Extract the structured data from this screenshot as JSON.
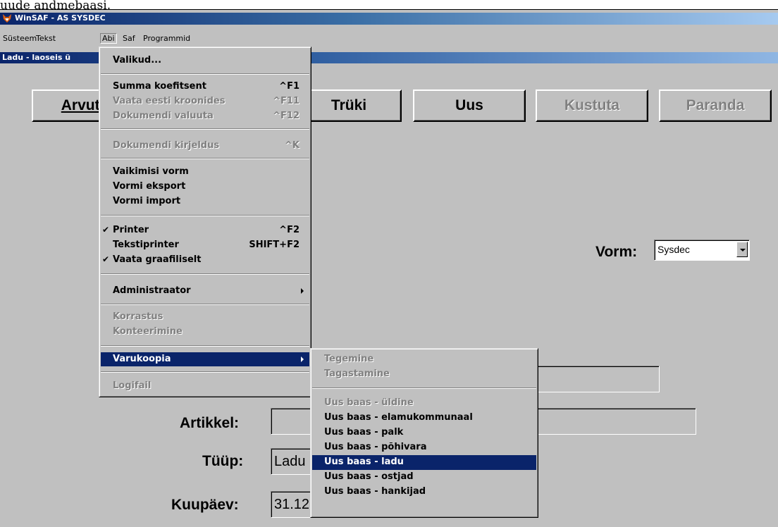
{
  "caption": "uude andmebaasi.",
  "window": {
    "title": "WinSAF - AS SYSDEC"
  },
  "menubar": [
    "Süsteem",
    "Tekst",
    "Abi",
    "Saf",
    "Programmid"
  ],
  "child_window": {
    "title": "Ladu - laoseis ü"
  },
  "toolbar": {
    "arvuta": "Arvuta",
    "truki": "Trüki",
    "uus": "Uus",
    "kustuta": "Kustuta",
    "paranda": "Paranda"
  },
  "form": {
    "vorm_label": "Vorm:",
    "vorm_value": "Sysdec",
    "artikkel_label": "Artikkel:",
    "artikkel_value": "",
    "tyyp_label": "Tüüp:",
    "tyyp_value": "Ladu",
    "kuupaev_label": "Kuupäev:",
    "kuupaev_value": "31.12"
  },
  "abi_menu": [
    {
      "label": "Valikud...",
      "shortcut": "",
      "disabled": false,
      "checked": false,
      "submenu": false
    },
    {
      "label": "Summa koefitsent",
      "shortcut": "^F1",
      "disabled": false,
      "checked": false,
      "submenu": false
    },
    {
      "label": "Vaata eesti kroonides",
      "shortcut": "^F11",
      "disabled": true,
      "checked": false,
      "submenu": false
    },
    {
      "label": "Dokumendi valuuta",
      "shortcut": "^F12",
      "disabled": true,
      "checked": false,
      "submenu": false
    },
    {
      "label": "Dokumendi kirjeldus",
      "shortcut": "^K",
      "disabled": true,
      "checked": false,
      "submenu": false
    },
    {
      "label": "Vaikimisi vorm",
      "shortcut": "",
      "disabled": false,
      "checked": false,
      "submenu": false
    },
    {
      "label": "Vormi eksport",
      "shortcut": "",
      "disabled": false,
      "checked": false,
      "submenu": false
    },
    {
      "label": "Vormi import",
      "shortcut": "",
      "disabled": false,
      "checked": false,
      "submenu": false
    },
    {
      "label": "Printer",
      "shortcut": "^F2",
      "disabled": false,
      "checked": true,
      "submenu": false
    },
    {
      "label": "Tekstiprinter",
      "shortcut": "SHIFT+F2",
      "disabled": false,
      "checked": false,
      "submenu": false
    },
    {
      "label": "Vaata graafiliselt",
      "shortcut": "",
      "disabled": false,
      "checked": true,
      "submenu": false
    },
    {
      "label": "Administraator",
      "shortcut": "",
      "disabled": false,
      "checked": false,
      "submenu": true
    },
    {
      "label": "Korrastus",
      "shortcut": "",
      "disabled": true,
      "checked": false,
      "submenu": false
    },
    {
      "label": "Konteerimine",
      "shortcut": "",
      "disabled": true,
      "checked": false,
      "submenu": false
    },
    {
      "label": "Varukoopia",
      "shortcut": "",
      "disabled": false,
      "checked": false,
      "submenu": true,
      "highlighted": true
    },
    {
      "label": "Logifail",
      "shortcut": "",
      "disabled": true,
      "checked": false,
      "submenu": false
    }
  ],
  "varukoopia_menu": [
    {
      "label": "Tegemine",
      "disabled": true
    },
    {
      "label": "Tagastamine",
      "disabled": true
    },
    {
      "label": "Uus baas - üldine",
      "disabled": true
    },
    {
      "label": "Uus baas - elamukommunaal",
      "disabled": false
    },
    {
      "label": "Uus baas - palk",
      "disabled": false
    },
    {
      "label": "Uus baas - põhivara",
      "disabled": false
    },
    {
      "label": "Uus baas - ladu",
      "disabled": false,
      "highlighted": true
    },
    {
      "label": "Uus baas - ostjad",
      "disabled": false
    },
    {
      "label": "Uus baas - hankijad",
      "disabled": false
    }
  ],
  "colors": {
    "face": "#c0c0c0",
    "highlight": "#0a246a",
    "title_start": "#0a246a"
  },
  "icons": {
    "app": "fox-icon",
    "check": "check-icon",
    "submenu_arrow": "submenu-arrow-icon",
    "dropdown": "dropdown-arrow-icon"
  }
}
